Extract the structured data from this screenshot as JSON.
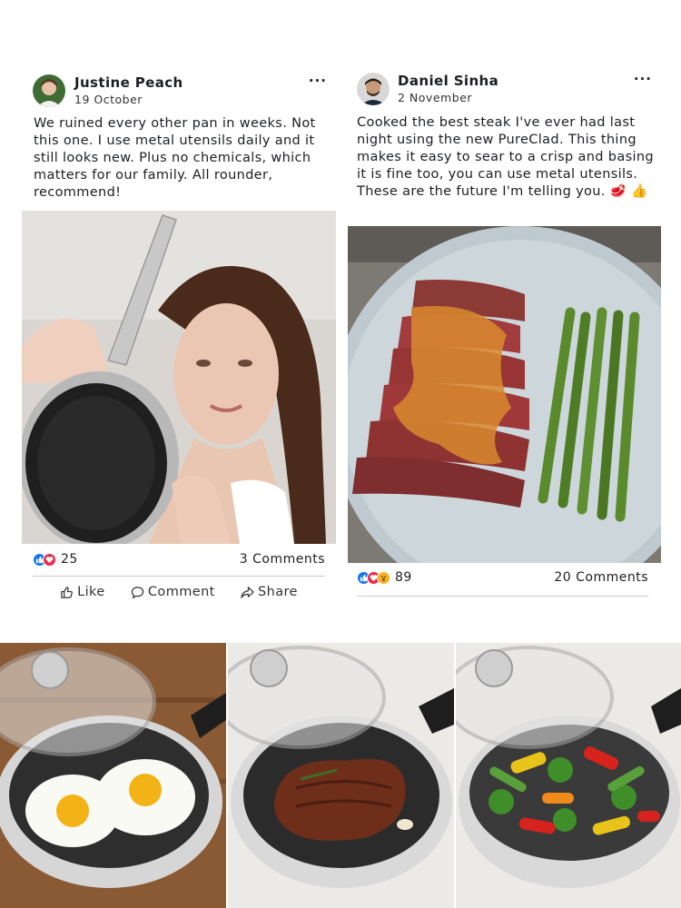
{
  "posts": [
    {
      "author": "Justine Peach",
      "date": "19 October",
      "more": "···",
      "text": "We ruined every other pan in weeks. Not this one. I use metal utensils daily and it still looks new. Plus no chemicals, which matters for our family. All rounder, recommend!",
      "reaction_count": "25",
      "comments": "3 Comments",
      "actions": {
        "like": "Like",
        "comment": "Comment",
        "share": "Share"
      }
    },
    {
      "author": "Daniel Sinha",
      "date": "2 November",
      "more": "···",
      "text": "Cooked the best steak I've ever had last night using the new PureClad. This thing makes it easy to sear to a crisp and basing it is fine too, you can use metal utensils. These are the future I'm telling you. 🥩 👍",
      "reaction_count": "89",
      "comments": "20 Comments"
    }
  ],
  "icons": {
    "like_reaction": "thumbs-up",
    "love_reaction": "heart",
    "wow_reaction": "wow-face"
  },
  "colors": {
    "like_blue": "#1877f2",
    "love_red": "#f0284a",
    "wow_yellow": "#f7b125"
  }
}
